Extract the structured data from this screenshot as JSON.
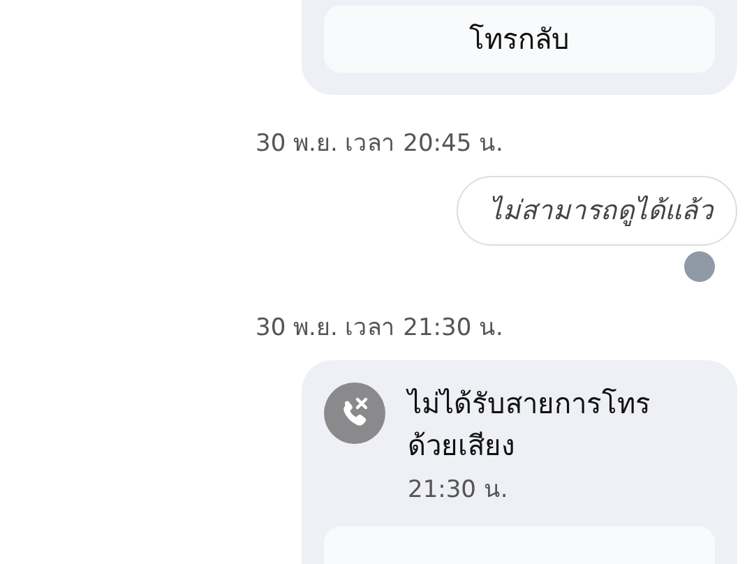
{
  "messages": [
    {
      "kind": "call",
      "button": "โทรกลับ"
    },
    {
      "kind": "timestamp",
      "text": "30 พ.ย. เวลา 20:45 น."
    },
    {
      "kind": "text",
      "text": "ไม่สามารถดูได้แล้ว",
      "seen": true
    },
    {
      "kind": "timestamp",
      "text": "30 พ.ย. เวลา 21:30 น."
    },
    {
      "kind": "call",
      "title": "ไม่ได้รับสายการโทรด้วยเสียง",
      "time": "21:30 น."
    }
  ]
}
